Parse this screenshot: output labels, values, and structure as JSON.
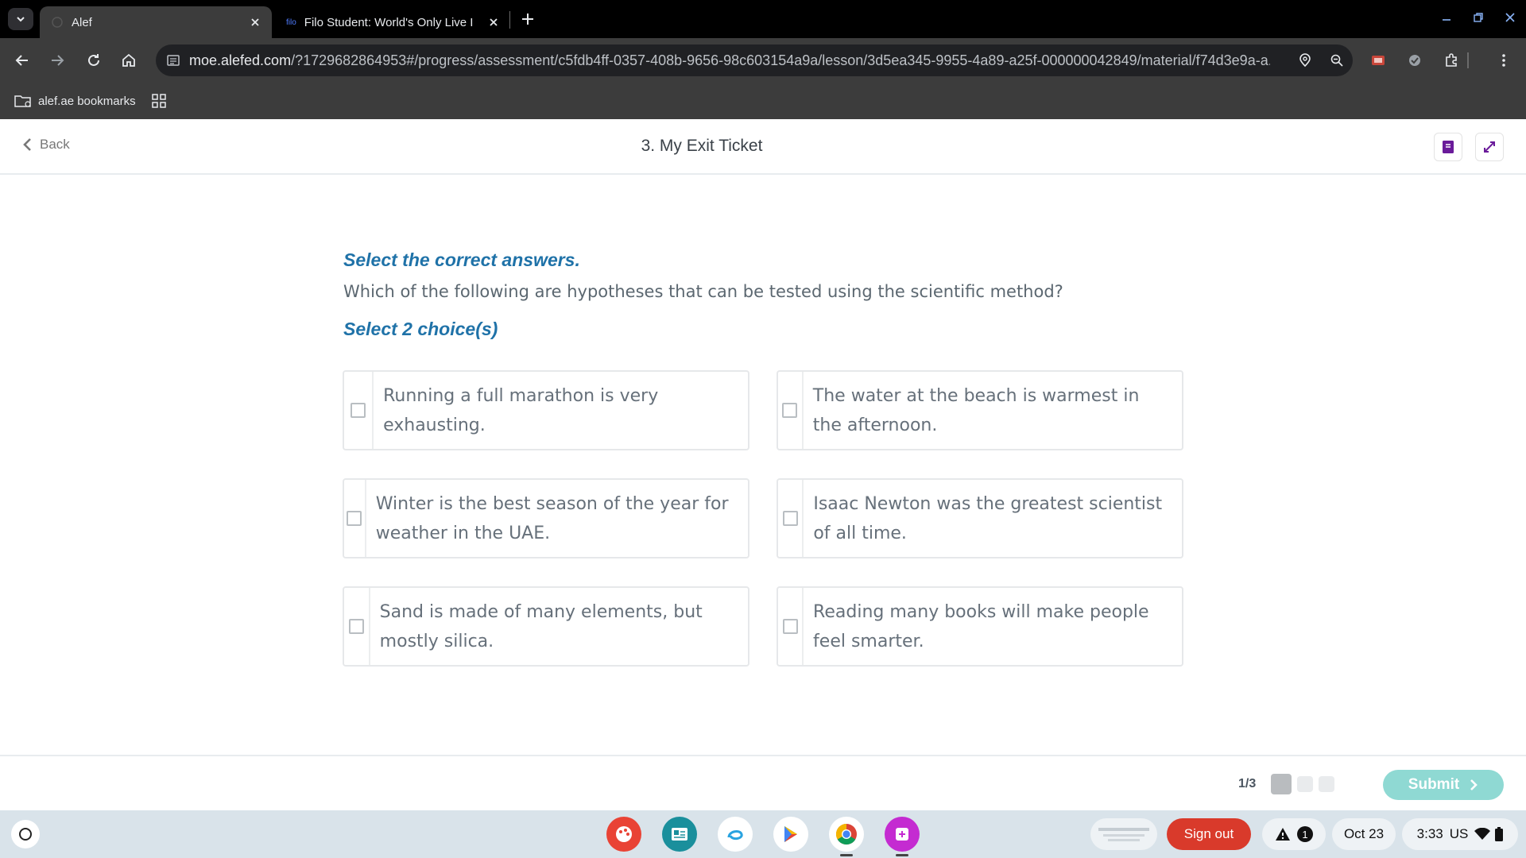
{
  "browser": {
    "tabs": [
      {
        "title": "Alef",
        "active": true
      },
      {
        "title": "Filo Student: World's Only Live I",
        "favicon_text": "filo",
        "active": false
      }
    ],
    "url_domain": "moe.alefed.com",
    "url_rest": "/?1729682864953#/progress/assessment/c5fdb4ff-0357-408b-9656-98c603154a9a/lesson/3d5ea345-9955-4a89-a25f-000000042849/material/f74d3e9a-a...",
    "bookmark_folder": "alef.ae bookmarks"
  },
  "page": {
    "back_label": "Back",
    "title": "3. My Exit Ticket",
    "instruction": "Select the correct answers.",
    "question": "Which of the following are hypotheses that can be tested using the scientific method?",
    "select_count": "Select 2 choice(s)",
    "choices": [
      {
        "text": "Running a full marathon is very exhausting.",
        "checked": false
      },
      {
        "text": "The water at the beach is warmest in the afternoon.",
        "checked": false
      },
      {
        "text": "Winter is the best season of the year for weather in the UAE.",
        "checked": false
      },
      {
        "text": "Isaac Newton was the greatest scientist of all time.",
        "checked": false
      },
      {
        "text": "Sand is made of many elements, but mostly silica.",
        "checked": false
      },
      {
        "text": "Reading many books will make people feel smarter.",
        "checked": false
      }
    ],
    "progress_text": "1/3",
    "progress_current": 1,
    "progress_total": 3,
    "submit_label": "Submit"
  },
  "shelf": {
    "sign_out_label": "Sign out",
    "notification_count": "1",
    "date": "Oct 23",
    "time": "3:33",
    "locale": "US"
  },
  "colors": {
    "accent_blue": "#1f72a8",
    "submit_teal": "#8fd9d3",
    "sign_out_red": "#d93a2b"
  }
}
